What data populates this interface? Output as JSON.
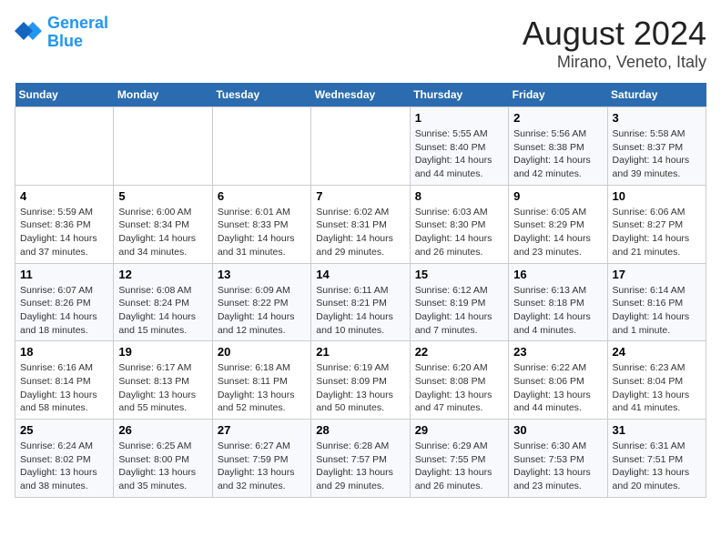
{
  "header": {
    "logo_line1": "General",
    "logo_line2": "Blue",
    "title": "August 2024",
    "subtitle": "Mirano, Veneto, Italy"
  },
  "weekdays": [
    "Sunday",
    "Monday",
    "Tuesday",
    "Wednesday",
    "Thursday",
    "Friday",
    "Saturday"
  ],
  "weeks": [
    [
      {
        "day": "",
        "info": ""
      },
      {
        "day": "",
        "info": ""
      },
      {
        "day": "",
        "info": ""
      },
      {
        "day": "",
        "info": ""
      },
      {
        "day": "1",
        "info": "Sunrise: 5:55 AM\nSunset: 8:40 PM\nDaylight: 14 hours\nand 44 minutes."
      },
      {
        "day": "2",
        "info": "Sunrise: 5:56 AM\nSunset: 8:38 PM\nDaylight: 14 hours\nand 42 minutes."
      },
      {
        "day": "3",
        "info": "Sunrise: 5:58 AM\nSunset: 8:37 PM\nDaylight: 14 hours\nand 39 minutes."
      }
    ],
    [
      {
        "day": "4",
        "info": "Sunrise: 5:59 AM\nSunset: 8:36 PM\nDaylight: 14 hours\nand 37 minutes."
      },
      {
        "day": "5",
        "info": "Sunrise: 6:00 AM\nSunset: 8:34 PM\nDaylight: 14 hours\nand 34 minutes."
      },
      {
        "day": "6",
        "info": "Sunrise: 6:01 AM\nSunset: 8:33 PM\nDaylight: 14 hours\nand 31 minutes."
      },
      {
        "day": "7",
        "info": "Sunrise: 6:02 AM\nSunset: 8:31 PM\nDaylight: 14 hours\nand 29 minutes."
      },
      {
        "day": "8",
        "info": "Sunrise: 6:03 AM\nSunset: 8:30 PM\nDaylight: 14 hours\nand 26 minutes."
      },
      {
        "day": "9",
        "info": "Sunrise: 6:05 AM\nSunset: 8:29 PM\nDaylight: 14 hours\nand 23 minutes."
      },
      {
        "day": "10",
        "info": "Sunrise: 6:06 AM\nSunset: 8:27 PM\nDaylight: 14 hours\nand 21 minutes."
      }
    ],
    [
      {
        "day": "11",
        "info": "Sunrise: 6:07 AM\nSunset: 8:26 PM\nDaylight: 14 hours\nand 18 minutes."
      },
      {
        "day": "12",
        "info": "Sunrise: 6:08 AM\nSunset: 8:24 PM\nDaylight: 14 hours\nand 15 minutes."
      },
      {
        "day": "13",
        "info": "Sunrise: 6:09 AM\nSunset: 8:22 PM\nDaylight: 14 hours\nand 12 minutes."
      },
      {
        "day": "14",
        "info": "Sunrise: 6:11 AM\nSunset: 8:21 PM\nDaylight: 14 hours\nand 10 minutes."
      },
      {
        "day": "15",
        "info": "Sunrise: 6:12 AM\nSunset: 8:19 PM\nDaylight: 14 hours\nand 7 minutes."
      },
      {
        "day": "16",
        "info": "Sunrise: 6:13 AM\nSunset: 8:18 PM\nDaylight: 14 hours\nand 4 minutes."
      },
      {
        "day": "17",
        "info": "Sunrise: 6:14 AM\nSunset: 8:16 PM\nDaylight: 14 hours\nand 1 minute."
      }
    ],
    [
      {
        "day": "18",
        "info": "Sunrise: 6:16 AM\nSunset: 8:14 PM\nDaylight: 13 hours\nand 58 minutes."
      },
      {
        "day": "19",
        "info": "Sunrise: 6:17 AM\nSunset: 8:13 PM\nDaylight: 13 hours\nand 55 minutes."
      },
      {
        "day": "20",
        "info": "Sunrise: 6:18 AM\nSunset: 8:11 PM\nDaylight: 13 hours\nand 52 minutes."
      },
      {
        "day": "21",
        "info": "Sunrise: 6:19 AM\nSunset: 8:09 PM\nDaylight: 13 hours\nand 50 minutes."
      },
      {
        "day": "22",
        "info": "Sunrise: 6:20 AM\nSunset: 8:08 PM\nDaylight: 13 hours\nand 47 minutes."
      },
      {
        "day": "23",
        "info": "Sunrise: 6:22 AM\nSunset: 8:06 PM\nDaylight: 13 hours\nand 44 minutes."
      },
      {
        "day": "24",
        "info": "Sunrise: 6:23 AM\nSunset: 8:04 PM\nDaylight: 13 hours\nand 41 minutes."
      }
    ],
    [
      {
        "day": "25",
        "info": "Sunrise: 6:24 AM\nSunset: 8:02 PM\nDaylight: 13 hours\nand 38 minutes."
      },
      {
        "day": "26",
        "info": "Sunrise: 6:25 AM\nSunset: 8:00 PM\nDaylight: 13 hours\nand 35 minutes."
      },
      {
        "day": "27",
        "info": "Sunrise: 6:27 AM\nSunset: 7:59 PM\nDaylight: 13 hours\nand 32 minutes."
      },
      {
        "day": "28",
        "info": "Sunrise: 6:28 AM\nSunset: 7:57 PM\nDaylight: 13 hours\nand 29 minutes."
      },
      {
        "day": "29",
        "info": "Sunrise: 6:29 AM\nSunset: 7:55 PM\nDaylight: 13 hours\nand 26 minutes."
      },
      {
        "day": "30",
        "info": "Sunrise: 6:30 AM\nSunset: 7:53 PM\nDaylight: 13 hours\nand 23 minutes."
      },
      {
        "day": "31",
        "info": "Sunrise: 6:31 AM\nSunset: 7:51 PM\nDaylight: 13 hours\nand 20 minutes."
      }
    ]
  ]
}
